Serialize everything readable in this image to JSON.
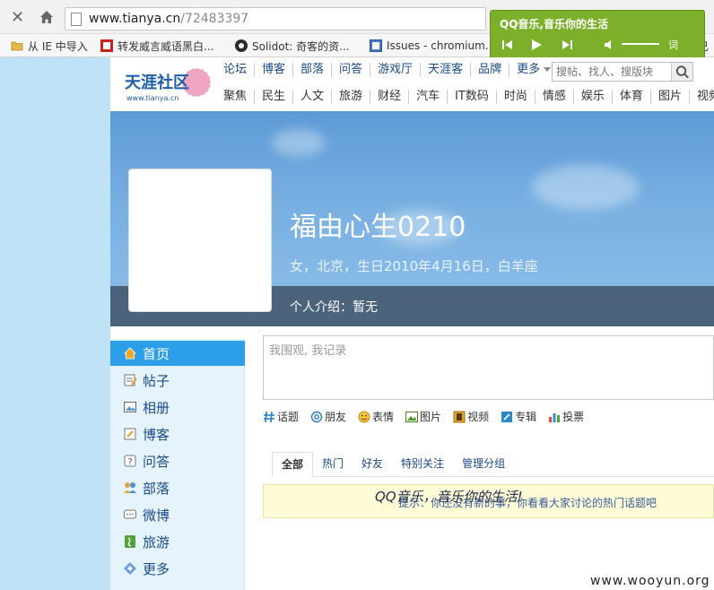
{
  "browser": {
    "url_domain": "www.tianya.cn",
    "url_path": "/72483397",
    "bookmarks": [
      {
        "label": "从 IE 中导入"
      },
      {
        "label": "转发威言威语黑白..."
      },
      {
        "label": "Solidot: 奇客的资..."
      },
      {
        "label": "Issues - chromium..."
      }
    ],
    "bookmark_truncated": "自己"
  },
  "qq_music": {
    "title": "QQ音乐,音乐你的生活",
    "lyric_label": "词"
  },
  "site": {
    "logo_cn": "天涯社区",
    "logo_en": "www.tianya.cn",
    "nav_primary": [
      "论坛",
      "博客",
      "部落",
      "问答",
      "游戏厅",
      "天涯客",
      "品牌",
      "更多"
    ],
    "nav_secondary": [
      "聚焦",
      "民生",
      "人文",
      "旅游",
      "财经",
      "汽车",
      "IT数码",
      "时尚",
      "情感",
      "娱乐",
      "体育",
      "图片",
      "视频"
    ],
    "search_placeholder": "搜帖、找人、搜版块"
  },
  "profile": {
    "username": "福由心生0210",
    "info": "女，北京，生日2010年4月16日，白羊座",
    "bio": "个人介绍：暂无"
  },
  "menu": [
    {
      "label": "首页",
      "icon": "home-icon",
      "active": true
    },
    {
      "label": "帖子",
      "icon": "post-icon"
    },
    {
      "label": "相册",
      "icon": "album-icon"
    },
    {
      "label": "博客",
      "icon": "blog-icon"
    },
    {
      "label": "问答",
      "icon": "question-icon"
    },
    {
      "label": "部落",
      "icon": "group-icon"
    },
    {
      "label": "微博",
      "icon": "chat-icon"
    },
    {
      "label": "旅游",
      "icon": "travel-icon"
    },
    {
      "label": "更多",
      "icon": "more-icon"
    }
  ],
  "composer": {
    "placeholder": "我围观, 我记录",
    "tools": [
      "话题",
      "朋友",
      "表情",
      "图片",
      "视频",
      "专辑",
      "投票"
    ]
  },
  "tabs": [
    "全部",
    "热门",
    "好友",
    "特别关注",
    "管理分组"
  ],
  "notice": {
    "text": "提示：你还没有新的事，你看看大家讨论的热门话题吧",
    "overlay": "QQ音乐，音乐你的生活!"
  },
  "watermark": "www.wooyun.org"
}
